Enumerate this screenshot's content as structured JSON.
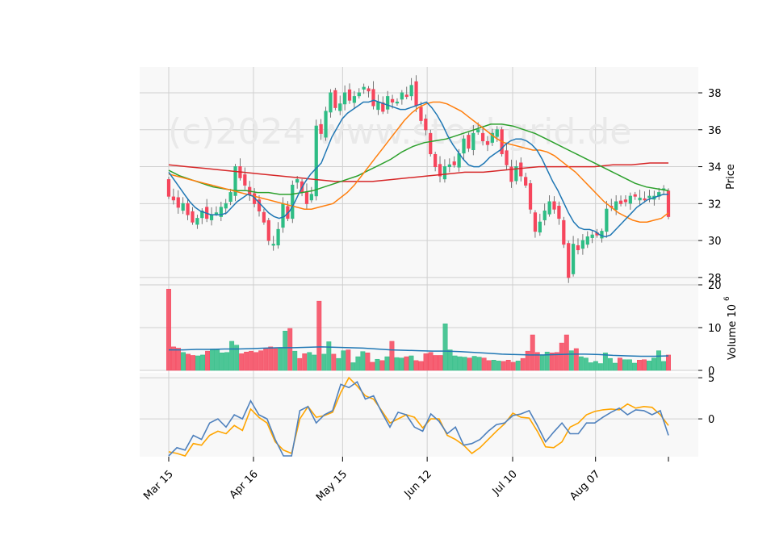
{
  "watermark": "(c)2024 www.stockgrid.de",
  "chart_data": [
    {
      "panel": "price",
      "type": "candlestick",
      "ylabel": "Price",
      "ylim": [
        27.6,
        39.4
      ],
      "yticks": [
        28,
        30,
        32,
        34,
        36,
        38
      ],
      "grid": true,
      "colors": {
        "up": "#2ebd85",
        "down": "#f6465d",
        "ma_fast": "#1f77b4",
        "ma_medium": "#ff7f0e",
        "ma_slow": "#2ca02c",
        "ma_long": "#d62728"
      },
      "candles_close": [
        32.4,
        32.2,
        31.8,
        32.0,
        31.4,
        31.0,
        31.2,
        31.6,
        31.2,
        31.4,
        31.5,
        31.8,
        32.0,
        32.6,
        34.0,
        33.4,
        33.0,
        32.5,
        32.0,
        31.6,
        31.0,
        30.0,
        29.8,
        30.6,
        32.0,
        31.2,
        33.0,
        33.3,
        32.6,
        32.0,
        32.5,
        36.2,
        35.8,
        37.0,
        38.0,
        37.2,
        37.4,
        38.0,
        37.6,
        37.8,
        38.0,
        38.3,
        38.1,
        37.3,
        37.5,
        37.0,
        37.8,
        37.5,
        37.5,
        38.0,
        37.8,
        38.4,
        37.3,
        36.5,
        36.0,
        34.7,
        34.0,
        33.5,
        34.0,
        34.1,
        34.1,
        34.7,
        35.5,
        35.0,
        35.8,
        36.0,
        35.4,
        35.2,
        35.8,
        36.0,
        34.7,
        34.1,
        33.2,
        34.0,
        33.5,
        33.0,
        31.7,
        30.5,
        31.0,
        31.6,
        32.1,
        31.7,
        31.2,
        29.8,
        28.0,
        29.8,
        29.5,
        30.0,
        30.2,
        30.3,
        30.3,
        30.5,
        31.7,
        31.8,
        32.1,
        32.0,
        32.1,
        32.4,
        32.4,
        32.3,
        32.2,
        32.4,
        32.4,
        32.6,
        32.8,
        31.3
      ],
      "ma_fast": [
        33.7,
        33.3,
        32.9,
        32.5,
        32.1,
        31.8,
        31.6,
        31.5,
        31.4,
        31.4,
        31.4,
        31.5,
        31.8,
        32.1,
        32.3,
        32.5,
        32.4,
        32.1,
        31.8,
        31.5,
        31.3,
        31.2,
        31.3,
        31.6,
        32.1,
        32.7,
        33.2,
        33.6,
        33.9,
        34.2,
        34.9,
        35.6,
        36.1,
        36.6,
        36.9,
        37.1,
        37.3,
        37.5,
        37.5,
        37.6,
        37.5,
        37.4,
        37.3,
        37.2,
        37.1,
        37.1,
        37.2,
        37.3,
        37.4,
        37.5,
        37.2,
        36.8,
        36.3,
        35.7,
        35.2,
        34.8,
        34.4,
        34.1,
        34.0,
        34.0,
        34.2,
        34.5,
        34.7,
        34.9,
        35.2,
        35.4,
        35.5,
        35.5,
        35.4,
        35.2,
        34.9,
        34.4,
        33.8,
        33.2,
        32.7,
        32.1,
        31.5,
        31.0,
        30.7,
        30.6,
        30.6,
        30.5,
        30.3,
        30.2,
        30.3,
        30.6,
        30.9,
        31.2,
        31.5,
        31.8,
        32.0,
        32.2,
        32.3,
        32.4,
        32.5,
        32.5
      ],
      "ma_medium": [
        33.6,
        33.5,
        33.4,
        33.3,
        33.2,
        33.1,
        33.0,
        32.9,
        32.8,
        32.7,
        32.6,
        32.5,
        32.4,
        32.3,
        32.2,
        32.1,
        32.0,
        31.9,
        31.8,
        31.7,
        31.7,
        31.8,
        31.9,
        32.0,
        32.3,
        32.6,
        33.0,
        33.5,
        34.0,
        34.5,
        35.0,
        35.5,
        36.0,
        36.5,
        36.9,
        37.2,
        37.4,
        37.5,
        37.5,
        37.4,
        37.2,
        37.0,
        36.7,
        36.4,
        36.1,
        35.8,
        35.5,
        35.3,
        35.2,
        35.1,
        35.0,
        34.9,
        34.9,
        34.8,
        34.6,
        34.3,
        34.0,
        33.7,
        33.3,
        32.9,
        32.5,
        32.1,
        31.8,
        31.5,
        31.3,
        31.1,
        31.0,
        31.0,
        31.1,
        31.2,
        31.5
      ],
      "ma_slow": [
        33.8,
        33.5,
        33.3,
        33.1,
        32.9,
        32.8,
        32.7,
        32.7,
        32.6,
        32.6,
        32.5,
        32.5,
        32.6,
        32.7,
        32.9,
        33.1,
        33.3,
        33.5,
        33.8,
        34.1,
        34.4,
        34.8,
        35.1,
        35.3,
        35.4,
        35.5,
        35.7,
        35.9,
        36.1,
        36.3,
        36.3,
        36.2,
        36.0,
        35.8,
        35.5,
        35.2,
        34.9,
        34.6,
        34.3,
        34.0,
        33.7,
        33.4,
        33.1,
        32.9,
        32.8,
        32.7
      ],
      "ma_long": [
        34.1,
        34.0,
        33.9,
        33.8,
        33.7,
        33.6,
        33.5,
        33.4,
        33.3,
        33.2,
        33.2,
        33.2,
        33.3,
        33.4,
        33.5,
        33.6,
        33.7,
        33.7,
        33.8,
        33.9,
        34.0,
        34.0,
        34.0,
        34.0,
        34.1,
        34.1,
        34.2,
        34.2
      ]
    },
    {
      "panel": "volume",
      "type": "bar",
      "ylabel": "Volume  10",
      "ylabel_exp": "6",
      "ylim": [
        0,
        20
      ],
      "yticks": [
        0,
        10,
        20
      ],
      "volumes": [
        19,
        5.5,
        5.2,
        4.2,
        3.8,
        3.5,
        3.4,
        3.6,
        4.5,
        5,
        4.8,
        4.1,
        4.2,
        6.8,
        5.9,
        3.9,
        4.3,
        4.5,
        4.2,
        4.6,
        5.2,
        5.5,
        5.1,
        5.2,
        9.2,
        9.8,
        4.5,
        2.8,
        3.9,
        4.2,
        3.6,
        16.2,
        3.8,
        6.7,
        3.8,
        2.8,
        4.6,
        4.8,
        1.8,
        3.2,
        4.4,
        4.1,
        1.9,
        2.6,
        2.3,
        3.2,
        6.8,
        3,
        2.9,
        3.2,
        3.4,
        2.3,
        2.1,
        3.9,
        4.2,
        3.5,
        3.5,
        10.9,
        4.8,
        3.4,
        3.2,
        3.1,
        2.9,
        3.3,
        3.1,
        2.9,
        2.3,
        2.4,
        2.2,
        2.1,
        2.4,
        1.9,
        2.2,
        2.8,
        4.5,
        8.3,
        4.2,
        3.6,
        4.3,
        4.1,
        4.2,
        6.4,
        8.3,
        4.6,
        5.1,
        3.2,
        2.9,
        1.8,
        2.1,
        1.6,
        4.1,
        2.8,
        1.7,
        2.9,
        2.5,
        2.5,
        1.7,
        2.4,
        2.5,
        2.2,
        2.9,
        4.6,
        2.1,
        3.6
      ],
      "avg_volume": [
        4.8,
        4.8,
        4.9,
        4.9,
        5.0,
        5.0,
        5.1,
        5.2,
        5.3,
        5.3,
        5.4,
        5.5,
        5.4,
        5.3,
        5.2,
        5.0,
        4.8,
        4.7,
        4.6,
        4.5,
        4.5,
        4.4,
        4.2,
        4.0,
        3.8,
        3.7,
        3.6,
        3.6,
        3.7,
        3.8,
        3.8,
        3.7,
        3.5,
        3.4,
        3.3,
        3.3,
        3.4
      ]
    },
    {
      "panel": "oscillator",
      "type": "line",
      "ylim": [
        -4.6,
        5.6
      ],
      "yticks": [
        0,
        5
      ],
      "colors": {
        "main": "#4f81bd",
        "signal": "#ffa500"
      },
      "line_main": [
        -4.5,
        -3.5,
        -3.8,
        -2,
        -2.5,
        -0.5,
        0,
        -1,
        0.5,
        0,
        2.2,
        0.5,
        0,
        -2.5,
        -4.5,
        -4.5,
        1,
        1.5,
        -0.5,
        0.5,
        1,
        4.2,
        3.8,
        4.5,
        2.4,
        2.8,
        0.8,
        -1,
        0.8,
        0.5,
        -1,
        -1.5,
        0.6,
        -0.3,
        -1.8,
        -1,
        -3.2,
        -3,
        -2.5,
        -1.5,
        -0.7,
        -0.5,
        0.4,
        0.6,
        1,
        -0.8,
        -2.8,
        -1.6,
        -0.5,
        -1.8,
        -1.8,
        -0.5,
        -0.5,
        0.2,
        0.8,
        1.3,
        0.5,
        1.1,
        1,
        0.5,
        1,
        -2
      ],
      "line_signal": [
        -4,
        -4.2,
        -4.5,
        -3,
        -3.2,
        -2,
        -1.5,
        -1.8,
        -0.8,
        -1.4,
        1.2,
        0.2,
        -0.5,
        -2.8,
        -3.8,
        -4.2,
        0,
        1.5,
        0.2,
        0.4,
        0.8,
        3.2,
        5,
        4,
        2.8,
        2.4,
        1,
        -0.5,
        0,
        0.5,
        0.2,
        -1.1,
        0,
        0,
        -2,
        -2.5,
        -3.2,
        -4.2,
        -3.5,
        -2.5,
        -1.5,
        -0.6,
        0.7,
        0.2,
        0.1,
        -1.5,
        -3.4,
        -3.5,
        -2.8,
        -1,
        -0.5,
        0.5,
        0.9,
        1.1,
        1.2,
        1.1,
        1.8,
        1.3,
        1.5,
        1.4,
        0.5,
        -0.8
      ]
    },
    {
      "panel": "x-axis",
      "tick_labels": [
        "Mar 15",
        "Apr 16",
        "May 15",
        "Jun 12",
        "Jul 10",
        "Aug 07"
      ]
    }
  ]
}
